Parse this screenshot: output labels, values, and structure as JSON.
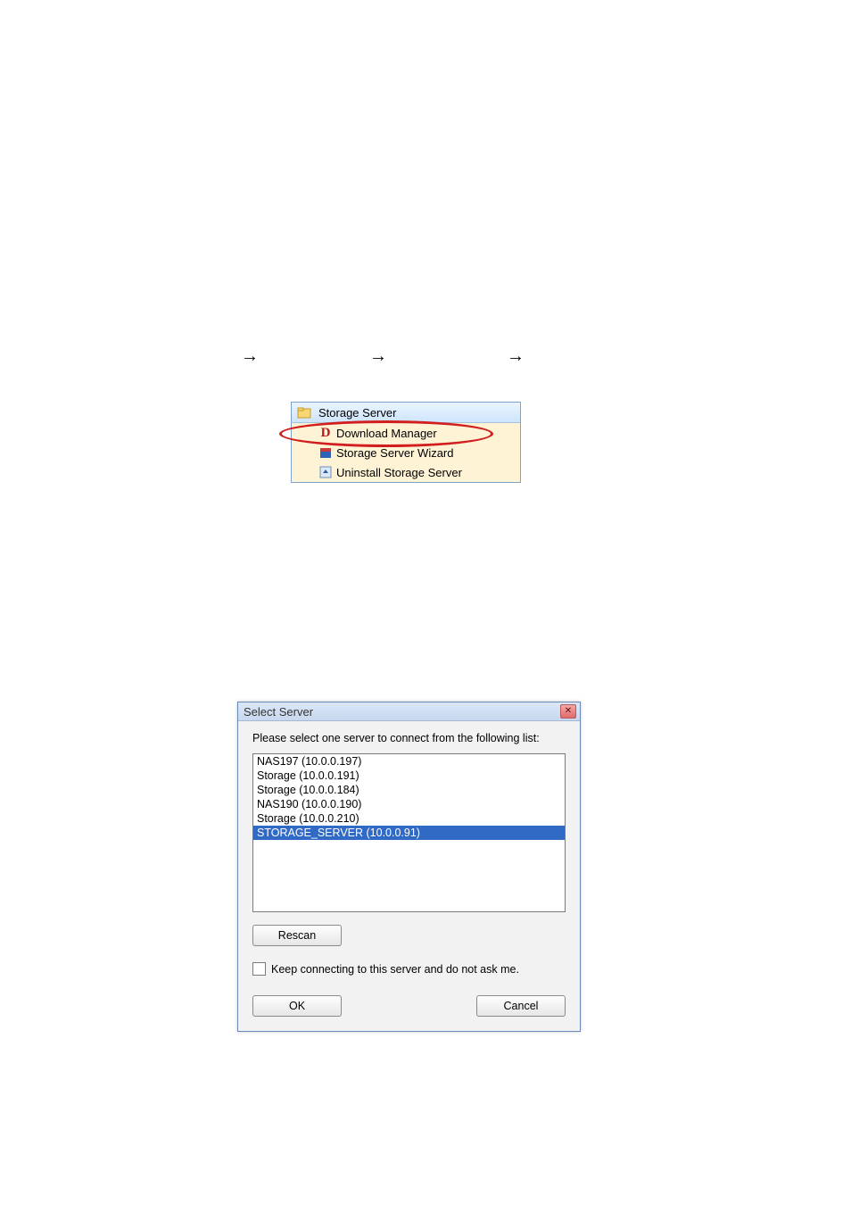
{
  "arrows": {
    "a1": "→",
    "a2": "→",
    "a3": "→"
  },
  "startmenu": {
    "folder": "Storage Server",
    "items": [
      {
        "label": "Download Manager",
        "icon": "D-icon"
      },
      {
        "label": "Storage Server Wizard",
        "icon": "wizard-icon"
      },
      {
        "label": "Uninstall Storage Server",
        "icon": "uninstall-icon"
      }
    ]
  },
  "dialog": {
    "title": "Select Server",
    "instruction": "Please select one server to connect from the following list:",
    "servers": [
      "NAS197 (10.0.0.197)",
      "Storage (10.0.0.191)",
      "Storage (10.0.0.184)",
      "NAS190 (10.0.0.190)",
      "Storage (10.0.0.210)",
      "STORAGE_SERVER (10.0.0.91)"
    ],
    "selected_index": 5,
    "rescan": "Rescan",
    "checkbox_label": "Keep connecting to this server and do not ask me.",
    "ok": "OK",
    "cancel": "Cancel"
  }
}
